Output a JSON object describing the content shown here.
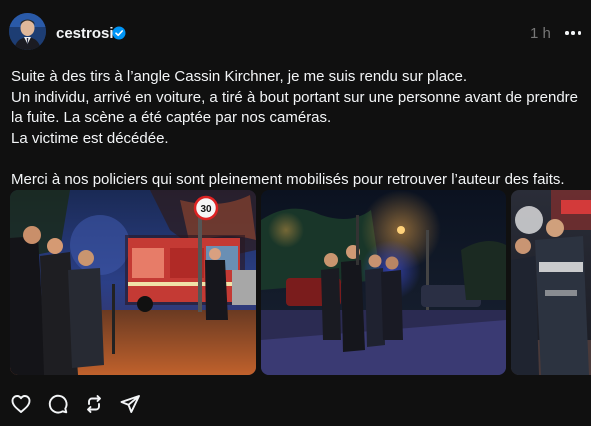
{
  "post": {
    "username": "cestrosi",
    "verified": true,
    "time": "1 h",
    "paragraphs": [
      "Suite à des tirs à l’angle Cassin Kirchner, je me suis rendu sur place.",
      "Un individu, arrivé en voiture, a tiré à bout portant sur une personne avant de prendre",
      "la fuite. La scène a été captée par nos caméras.",
      "La victime est décédée.",
      "Merci à nos policiers qui sont pleinement mobilisés pour retrouver l’auteur des faits."
    ],
    "speed_sign": "30",
    "media": [
      {
        "icon": "photo-fire-truck-night"
      },
      {
        "icon": "photo-police-street-night"
      },
      {
        "icon": "photo-police-officers"
      }
    ]
  },
  "actions": [
    {
      "icon": "heart-icon"
    },
    {
      "icon": "comment-icon"
    },
    {
      "icon": "repost-icon"
    },
    {
      "icon": "share-icon"
    }
  ],
  "colors": {
    "background": "#101010",
    "text": "#f3f5f7",
    "muted": "#777777",
    "verified": "#0095f6"
  }
}
